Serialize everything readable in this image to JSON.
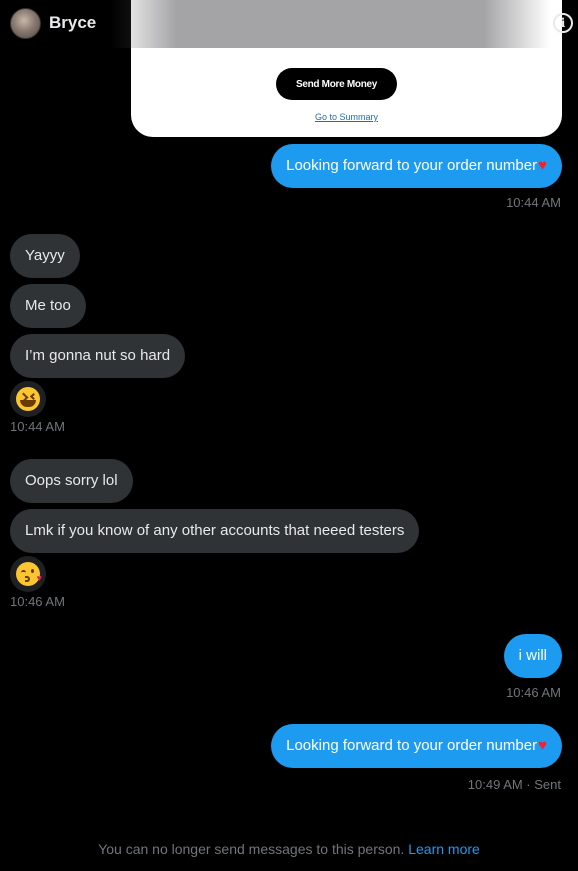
{
  "header": {
    "contact_name": "Bryce",
    "info_icon": "info-circle-icon"
  },
  "payment_card": {
    "send_more_label": "Send More Money",
    "summary_link": "Go to Summary"
  },
  "messages": [
    {
      "dir": "out",
      "text": "Looking forward to your order number",
      "heart": "♥"
    },
    {
      "dir": "in",
      "text": "Yayyy"
    },
    {
      "dir": "in",
      "text": "Me too"
    },
    {
      "dir": "in",
      "text": "I’m gonna nut so hard"
    },
    {
      "dir": "in",
      "text": "Oops sorry lol"
    },
    {
      "dir": "in",
      "text": "Lmk if you know of any other accounts that neeed testers"
    },
    {
      "dir": "out",
      "text": "i will"
    },
    {
      "dir": "out",
      "text": "Looking forward to your order number",
      "heart": "♥"
    }
  ],
  "timestamps": [
    "10:44 AM",
    "10:44 AM",
    "10:46 AM",
    "10:46 AM",
    "10:49 AM · Sent"
  ],
  "reactions": [
    {
      "icon": "laughing-face-emoji"
    },
    {
      "icon": "kissing-face-emoji"
    }
  ],
  "footer": {
    "notice": "You can no longer send messages to this person.",
    "learn_more": "Learn more"
  },
  "colors": {
    "outgoing_bubble": "#1d9bf0",
    "incoming_bubble": "#2f3336",
    "background": "#000000",
    "link": "#1d9bf0",
    "heart": "#f4212e"
  }
}
